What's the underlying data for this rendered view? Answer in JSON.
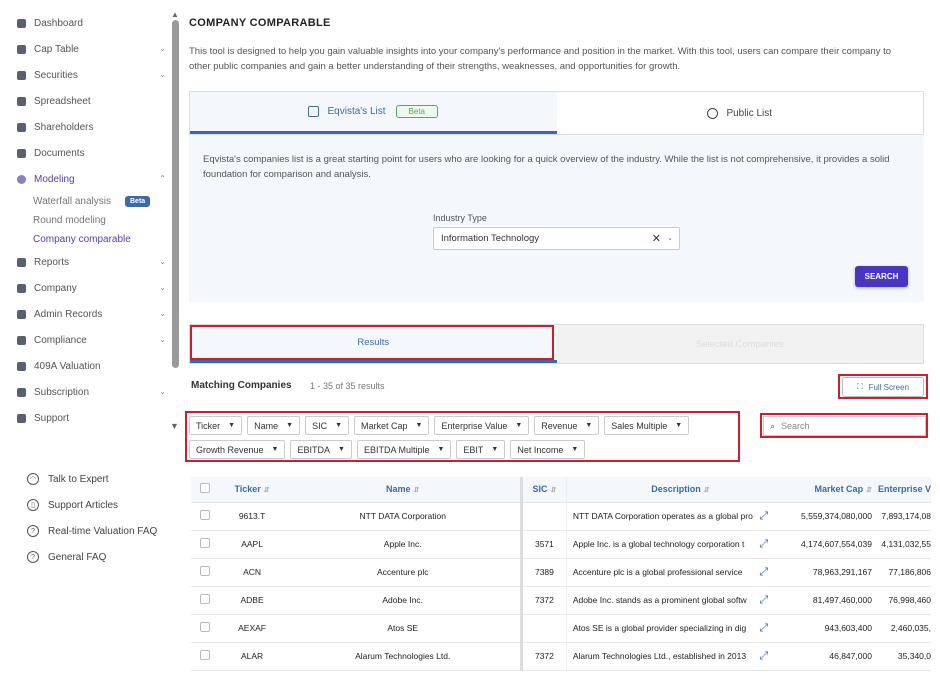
{
  "sidebar": {
    "items": [
      {
        "label": "Dashboard",
        "icon": "dashboard-icon",
        "has_chevron": false
      },
      {
        "label": "Cap Table",
        "icon": "pie-chart-icon",
        "has_chevron": true
      },
      {
        "label": "Securities",
        "icon": "document-icon",
        "has_chevron": true
      },
      {
        "label": "Spreadsheet",
        "icon": "grid-icon",
        "has_chevron": false
      },
      {
        "label": "Shareholders",
        "icon": "user-icon",
        "has_chevron": false
      },
      {
        "label": "Documents",
        "icon": "folder-icon",
        "has_chevron": false
      },
      {
        "label": "Modeling",
        "icon": "lightbulb-icon",
        "has_chevron": true,
        "expanded": true
      }
    ],
    "modeling_sub": [
      {
        "label": "Waterfall analysis",
        "badge": "Beta"
      },
      {
        "label": "Round modeling"
      },
      {
        "label": "Company comparable",
        "active": true
      }
    ],
    "items_after": [
      {
        "label": "Reports",
        "icon": "report-icon",
        "has_chevron": true
      },
      {
        "label": "Company",
        "icon": "building-icon",
        "has_chevron": true
      },
      {
        "label": "Admin Records",
        "icon": "records-icon",
        "has_chevron": true
      },
      {
        "label": "Compliance",
        "icon": "shield-icon",
        "has_chevron": true
      },
      {
        "label": "409A Valuation",
        "icon": "chart-icon",
        "has_chevron": false
      },
      {
        "label": "Subscription",
        "icon": "dollar-icon",
        "has_chevron": true
      },
      {
        "label": "Support",
        "icon": "support-icon",
        "has_chevron": false
      }
    ],
    "help": [
      {
        "label": "Talk to Expert",
        "icon": "headset-icon"
      },
      {
        "label": "Support Articles",
        "icon": "book-icon"
      },
      {
        "label": "Real-time Valuation FAQ",
        "icon": "question-icon"
      },
      {
        "label": "General FAQ",
        "icon": "question-icon"
      }
    ]
  },
  "main": {
    "title": "COMPANY COMPARABLE",
    "description": "This tool is designed to help you gain valuable insights into your company's performance and position in the market. With this tool, users can compare their company to other public companies and gain a better understanding of their strengths, weaknesses, and opportunities for growth.",
    "tabs": [
      {
        "label": "Eqvista's List",
        "badge": "Beta",
        "active": true
      },
      {
        "label": "Public List",
        "active": false
      }
    ],
    "panel_text": "Eqvista's companies list is a great starting point for users who are looking for a quick overview of the industry. While the list is not comprehensive, it provides a solid foundation for comparison and analysis.",
    "industry_label": "Industry Type",
    "industry_value": "Information Technology",
    "search_button": "SEARCH",
    "result_tabs": [
      {
        "label": "Results",
        "active": true
      },
      {
        "label": "Selected Companies",
        "active": false
      }
    ],
    "matching_title": "Matching Companies",
    "matching_count": "1 - 35 of 35 results",
    "fullscreen_label": "Full Screen",
    "filters_row1": [
      "Ticker",
      "Name",
      "SIC",
      "Market Cap",
      "Enterprise Value",
      "Revenue",
      "Sales Multiple"
    ],
    "filters_row2": [
      "Growth Revenue",
      "EBITDA",
      "EBITDA Multiple",
      "EBIT",
      "Net Income"
    ],
    "search_placeholder": "Search",
    "table": {
      "headers": [
        "Ticker",
        "Name",
        "SIC",
        "Description",
        "Market Cap",
        "Enterprise V"
      ],
      "rows": [
        {
          "ticker": "9613.T",
          "name": "NTT DATA Corporation",
          "sic": "",
          "description": "NTT DATA Corporation operates as a global pro",
          "market_cap": "5,559,374,080,000",
          "ev": "7,893,174,08"
        },
        {
          "ticker": "AAPL",
          "name": "Apple Inc.",
          "sic": "3571",
          "description": "Apple Inc. is a global technology corporation t",
          "market_cap": "4,174,607,554,039",
          "ev": "4,131,032,55"
        },
        {
          "ticker": "ACN",
          "name": "Accenture plc",
          "sic": "7389",
          "description": "Accenture plc is a global professional service",
          "market_cap": "78,963,291,167",
          "ev": "77,186,806"
        },
        {
          "ticker": "ADBE",
          "name": "Adobe Inc.",
          "sic": "7372",
          "description": "Adobe Inc. stands as a prominent global softw",
          "market_cap": "81,497,460,000",
          "ev": "76,998,460"
        },
        {
          "ticker": "AEXAF",
          "name": "Atos SE",
          "sic": "",
          "description": "Atos SE is a global provider specializing in dig",
          "market_cap": "943,603,400",
          "ev": "2,460,035,"
        },
        {
          "ticker": "ALAR",
          "name": "Alarum Technologies Ltd.",
          "sic": "7372",
          "description": "Alarum Technologies Ltd., established in 2013",
          "market_cap": "46,847,000",
          "ev": "35,340,0"
        }
      ]
    }
  },
  "colors": {
    "accent": "#3b6aa8",
    "primary_button": "#4a35c0",
    "highlight_box": "#c8202c",
    "active_nav": "#5b3bb0"
  }
}
